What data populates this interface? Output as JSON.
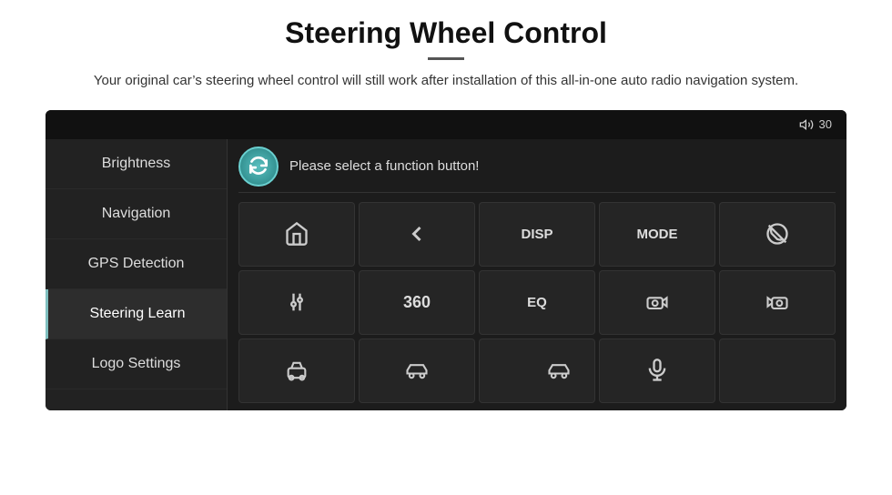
{
  "header": {
    "title": "Steering Wheel Control",
    "divider": true,
    "subtitle": "Your original car’s steering wheel control will still work after installation of this all-in-one auto radio navigation system."
  },
  "topbar": {
    "volume_icon": "🔊",
    "volume_value": "30"
  },
  "sidebar": {
    "items": [
      {
        "label": "Brightness",
        "active": false
      },
      {
        "label": "Navigation",
        "active": false
      },
      {
        "label": "GPS Detection",
        "active": false
      },
      {
        "label": "Steering Learn",
        "active": true
      },
      {
        "label": "Logo Settings",
        "active": false
      }
    ]
  },
  "main": {
    "prompt": "Please select a function button!",
    "buttons": [
      {
        "type": "icon",
        "label": "home"
      },
      {
        "type": "icon",
        "label": "back"
      },
      {
        "type": "text",
        "label": "DISP"
      },
      {
        "type": "text",
        "label": "MODE"
      },
      {
        "type": "icon",
        "label": "no-call"
      },
      {
        "type": "icon",
        "label": "equalizer"
      },
      {
        "type": "text",
        "label": "360"
      },
      {
        "type": "text",
        "label": "EQ"
      },
      {
        "type": "icon",
        "label": "camera-left"
      },
      {
        "type": "icon",
        "label": "camera-right"
      },
      {
        "type": "icon",
        "label": "car-front"
      },
      {
        "type": "icon",
        "label": "car-side-left"
      },
      {
        "type": "icon",
        "label": "car-side-right"
      },
      {
        "type": "icon",
        "label": "microphone"
      },
      {
        "type": "empty",
        "label": ""
      }
    ]
  }
}
